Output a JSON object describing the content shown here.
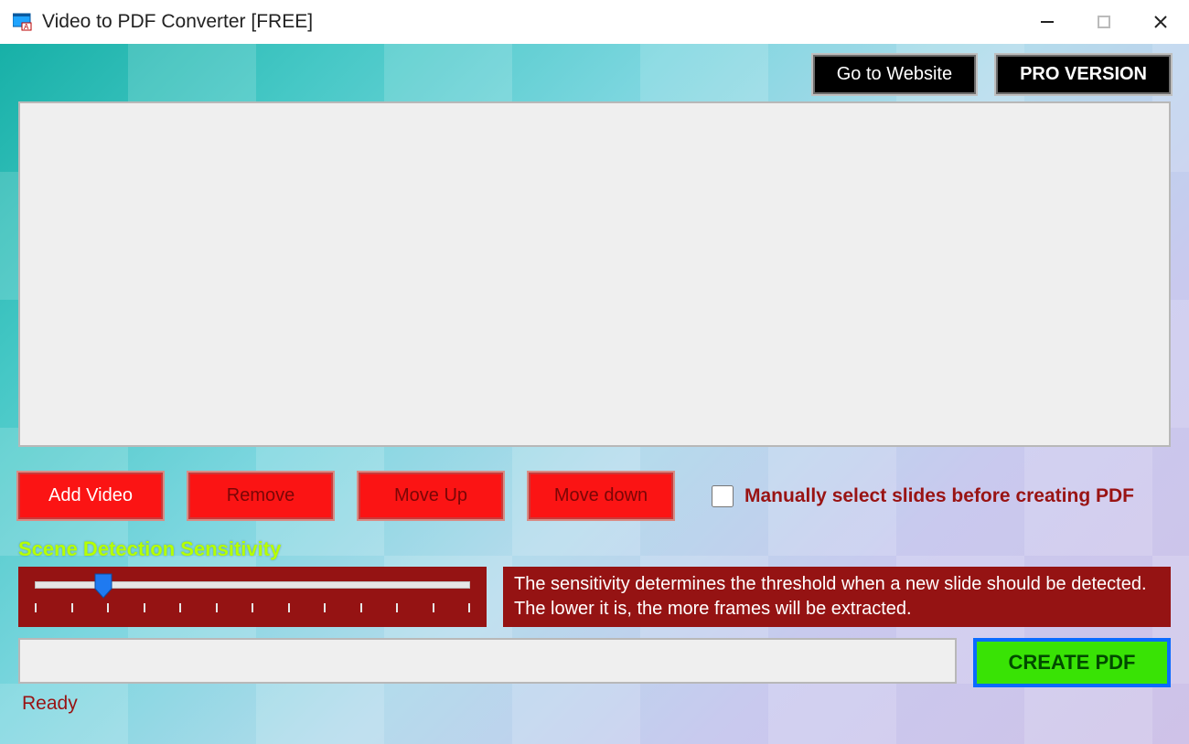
{
  "window": {
    "title": "Video to PDF Converter [FREE]"
  },
  "topbar": {
    "website_label": "Go to Website",
    "pro_label": "PRO VERSION"
  },
  "buttons": {
    "add_video": "Add Video",
    "remove": "Remove",
    "move_up": "Move Up",
    "move_down": "Move down"
  },
  "checkbox": {
    "manual_select_label": "Manually select slides before creating PDF",
    "checked": false
  },
  "sensitivity": {
    "label": "Scene Detection Sensitivity",
    "value": 2,
    "min": 0,
    "max": 12,
    "description": "The sensitivity determines the threshold when a new slide should be detected. The lower it is, the more frames will be extracted."
  },
  "create_button_label": "CREATE PDF",
  "status_text": "Ready",
  "progress_percent": 0
}
